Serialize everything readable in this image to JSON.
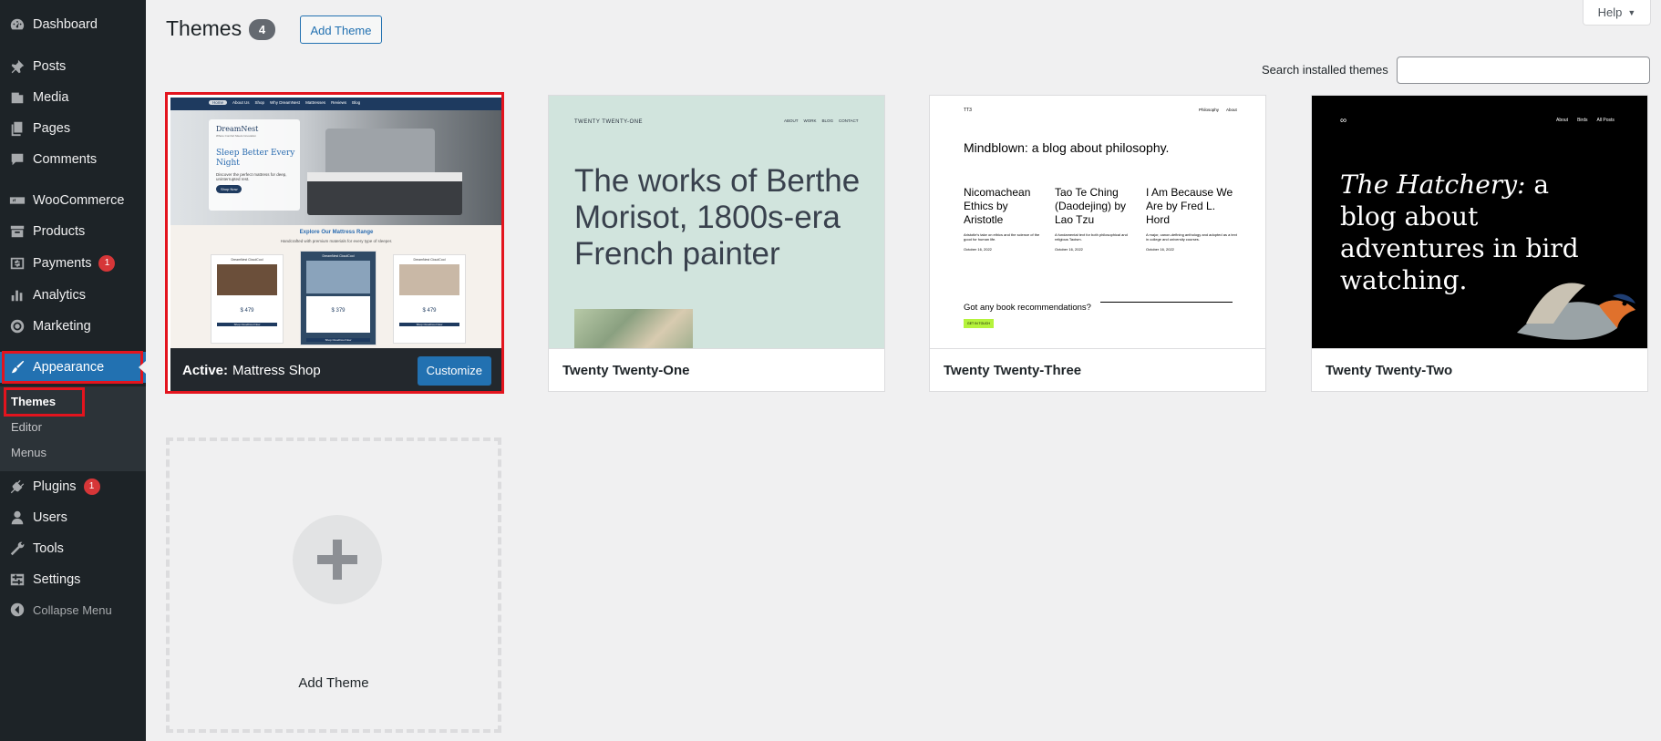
{
  "sidebar": {
    "items": [
      {
        "label": "Dashboard",
        "icon": "dashboard-icon"
      },
      {
        "label": "Posts",
        "icon": "pin-icon"
      },
      {
        "label": "Media",
        "icon": "media-icon"
      },
      {
        "label": "Pages",
        "icon": "pages-icon"
      },
      {
        "label": "Comments",
        "icon": "comment-icon"
      },
      {
        "label": "WooCommerce",
        "icon": "woocommerce-icon"
      },
      {
        "label": "Products",
        "icon": "archive-icon"
      },
      {
        "label": "Payments",
        "icon": "payments-icon",
        "badge": "1"
      },
      {
        "label": "Analytics",
        "icon": "bar-chart-icon"
      },
      {
        "label": "Marketing",
        "icon": "megaphone-icon"
      },
      {
        "label": "Appearance",
        "icon": "paintbrush-icon"
      },
      {
        "label": "Plugins",
        "icon": "plugin-icon",
        "badge": "1"
      },
      {
        "label": "Users",
        "icon": "user-icon"
      },
      {
        "label": "Tools",
        "icon": "wrench-icon"
      },
      {
        "label": "Settings",
        "icon": "settings-icon"
      },
      {
        "label": "Collapse Menu",
        "icon": "collapse-icon"
      }
    ],
    "submenu": [
      "Themes",
      "Editor",
      "Menus"
    ]
  },
  "header": {
    "title": "Themes",
    "count": "4",
    "add_theme_label": "Add Theme",
    "help_label": "Help",
    "search_label": "Search installed themes",
    "search_value": ""
  },
  "themes": [
    {
      "active_prefix": "Active:",
      "name": "Mattress Shop",
      "customize_label": "Customize",
      "preview": {
        "nav": [
          "Home",
          "About Us",
          "Shop",
          "Why DreamNest",
          "Mattresses",
          "Reviews",
          "Blog"
        ],
        "brand": "DreamNest",
        "brand_tagline": "Where Comfort Meets Innovation",
        "hero_title": "Sleep Better Every Night",
        "hero_text": "Discover the perfect mattress for deep, uninterrupted rest.",
        "hero_button": "Shop Now",
        "range_title": "Explore Our Mattress Range",
        "range_subtitle": "Handcrafted with premium materials for every type of sleeper.",
        "products": [
          {
            "name": "DreamNest CloudCool",
            "price": "$ 479",
            "button": "Shop CloudCool Now"
          },
          {
            "name": "DreamNest CloudCool",
            "price": "$ 379",
            "button": "Shop CloudCool Now"
          },
          {
            "name": "DreamNest CloudCool",
            "price": "$ 479",
            "button": "Shop CloudCool Now"
          }
        ]
      }
    },
    {
      "name": "Twenty Twenty-One",
      "preview": {
        "site": "TWENTY TWENTY-ONE",
        "nav": [
          "ABOUT",
          "WORK",
          "BLOG",
          "CONTACT"
        ],
        "headline": "The works of Berthe Morisot, 1800s-era French painter"
      }
    },
    {
      "name": "Twenty Twenty-Three",
      "preview": {
        "site": "TT3",
        "nav": [
          "Philosophy",
          "About"
        ],
        "headline": "Mindblown: a blog about philosophy.",
        "posts": [
          {
            "title": "Nicomachean Ethics by Aristotle",
            "excerpt": "Aristotle's take on ethics and the science of the good for human life.",
            "date": "October 16, 2022"
          },
          {
            "title": "Tao Te Ching (Daodejing) by Lao Tzu",
            "excerpt": "A fundamental text for both philosophical and religious Taoism.",
            "date": "October 16, 2022"
          },
          {
            "title": "I Am Because We Are by Fred L. Hord",
            "excerpt": "A major, canon-defining anthology and adopted as a text in college and university courses.",
            "date": "October 16, 2022"
          }
        ],
        "cta_text": "Got any book recommendations?",
        "cta_button": "GET IN TOUCH"
      }
    },
    {
      "name": "Twenty Twenty-Two",
      "preview": {
        "nav": [
          "About",
          "Birds",
          "All Posts"
        ],
        "headline_italic": "The Hatchery:",
        "headline_rest": "a blog about adventures in bird watching."
      }
    }
  ],
  "add_theme_tile": {
    "label": "Add Theme"
  },
  "colors": {
    "sidebar_bg": "#1d2327",
    "accent": "#2271b1",
    "highlight_box": "#e3141e",
    "badge": "#d63638"
  }
}
